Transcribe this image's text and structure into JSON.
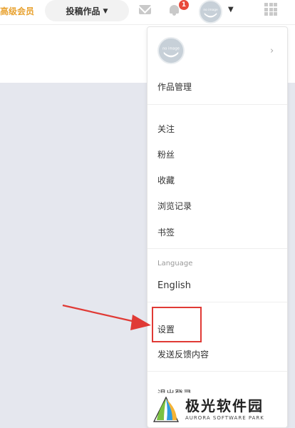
{
  "header": {
    "premium_label": "高级会员",
    "submit_label": "投稿作品",
    "notification_count": "1"
  },
  "avatar": {
    "text": "no image"
  },
  "menu": {
    "works_management": "作品管理",
    "follow": "关注",
    "fans": "粉丝",
    "favorites": "收藏",
    "history": "浏览记录",
    "bookmarks": "书签",
    "language_heading": "Language",
    "language_value": "English",
    "settings": "设置",
    "feedback": "发送反馈内容",
    "logout_partial": "退出登录"
  },
  "colors": {
    "accent_premium": "#e8a230",
    "badge": "#e84a3b",
    "highlight_box": "#e03a35",
    "content_bg": "#e5e7ee"
  },
  "watermark": {
    "cn": "极光软件园",
    "en": "AURORA SOFTWARE PARK"
  }
}
